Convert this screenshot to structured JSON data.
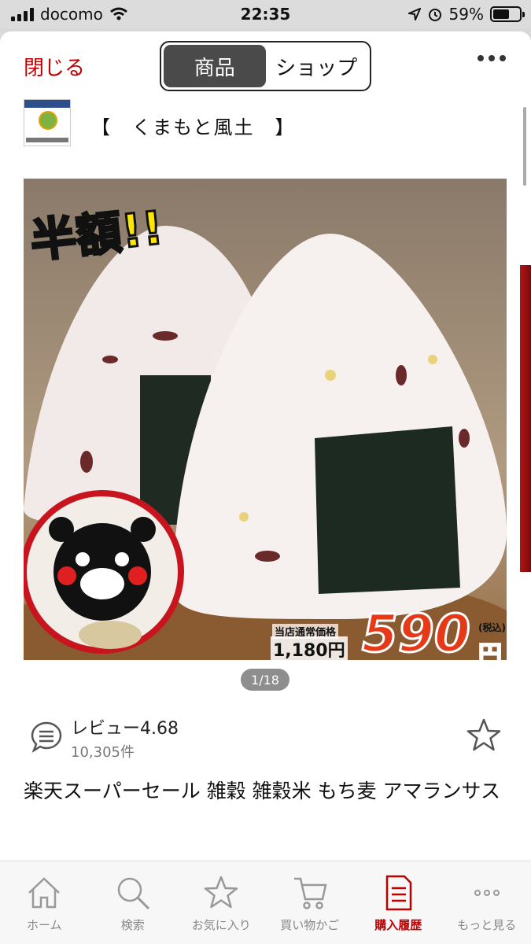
{
  "status_bar": {
    "carrier": "docomo",
    "time": "22:35",
    "battery": "59%"
  },
  "header": {
    "close_label": "閉じる",
    "segments": [
      "商品",
      "ショップ"
    ],
    "active_segment": 0
  },
  "shop": {
    "name": "【　くまもと風土　】"
  },
  "product_image": {
    "badge": "半額!!",
    "regular_price_label": "当店通常価格",
    "regular_price": "1,180円",
    "sale_price": "590",
    "yen": "円",
    "tax": "(税込)",
    "counter": "1/18"
  },
  "review": {
    "label": "レビュー4.68",
    "count": "10,305件"
  },
  "product_title": "楽天スーパーセール 雑穀 雑穀米 もち麦 アマランサス",
  "tabs": [
    {
      "label": "ホーム",
      "icon": "home-icon"
    },
    {
      "label": "検索",
      "icon": "search-icon"
    },
    {
      "label": "お気に入り",
      "icon": "star-icon"
    },
    {
      "label": "買い物かご",
      "icon": "cart-icon"
    },
    {
      "label": "購入履歴",
      "icon": "receipt-icon"
    },
    {
      "label": "もっと見る",
      "icon": "more-icon"
    }
  ],
  "active_tab": 4,
  "colors": {
    "accent": "#bf0000",
    "price_red": "#e53917",
    "badge_yellow": "#ffe600"
  }
}
